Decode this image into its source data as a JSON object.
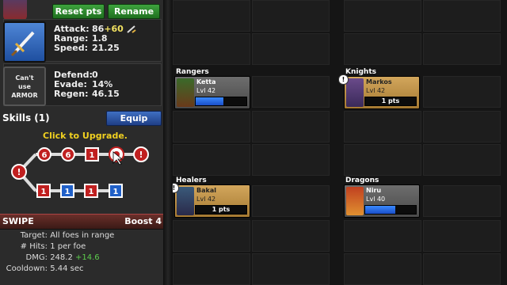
{
  "hero": {
    "name_partial": "...",
    "reset_label": "Reset pts",
    "rename_label": "Rename"
  },
  "weapon": {
    "icon": "sword-icon",
    "stats": [
      {
        "label": "Attack:",
        "value": "86",
        "bonus": "+60"
      },
      {
        "label": "Range:",
        "value": "1.8",
        "bonus": ""
      },
      {
        "label": "Speed:",
        "value": "21.25",
        "bonus": ""
      }
    ]
  },
  "armor": {
    "slot_text_1": "Can't",
    "slot_text_2": "use",
    "slot_text_3": "ARMOR",
    "stats": [
      {
        "label": "Defend:",
        "value": "0"
      },
      {
        "label": "Evade:",
        "value": "14%"
      },
      {
        "label": "Regen:",
        "value": "46.15"
      }
    ]
  },
  "skills": {
    "title": "Skills (1)",
    "equip_label": "Equip",
    "hint": "Click to Upgrade.",
    "nodes_top": [
      "6",
      "6",
      "1"
    ],
    "nodes_bottom": [
      "1",
      "1",
      "1",
      "1"
    ],
    "selected_skill": {
      "name": "SWIPE",
      "boost": "Boost 4",
      "target_label": "Target:",
      "target_value": "All foes in range",
      "hits_label": "# Hits:",
      "hits_value": "1 per foe",
      "dmg_label": "DMG:",
      "dmg_value": "248.2",
      "dmg_bonus": "+14.6",
      "cooldown_label": "Cooldown:",
      "cooldown_value": "5.44 sec"
    }
  },
  "roster": {
    "rangers": {
      "label": "Rangers",
      "unit": {
        "name": "Ketta",
        "level": "Lvl 42",
        "xp_fraction": 0.55,
        "pts": ""
      }
    },
    "knights": {
      "label": "Knights",
      "unit": {
        "name": "Markos",
        "level": "Lvl 42",
        "xp_fraction": 0,
        "pts": "1 pts",
        "alert": "!"
      }
    },
    "healers": {
      "label": "Healers",
      "unit": {
        "name": "Bakal",
        "level": "Lvl 42",
        "xp_fraction": 0,
        "pts": "1 pts",
        "alert": "!"
      }
    },
    "dragons": {
      "label": "Dragons",
      "unit": {
        "name": "Niru",
        "level": "Lvl 40",
        "xp_fraction": 0.6,
        "pts": ""
      }
    }
  },
  "colors": {
    "accent_green": "#3ea33e",
    "accent_blue": "#3f6fc2",
    "gold_card": "#d2a65c",
    "xp_blue": "#2a6ae8",
    "skill_red": "#c02020"
  }
}
